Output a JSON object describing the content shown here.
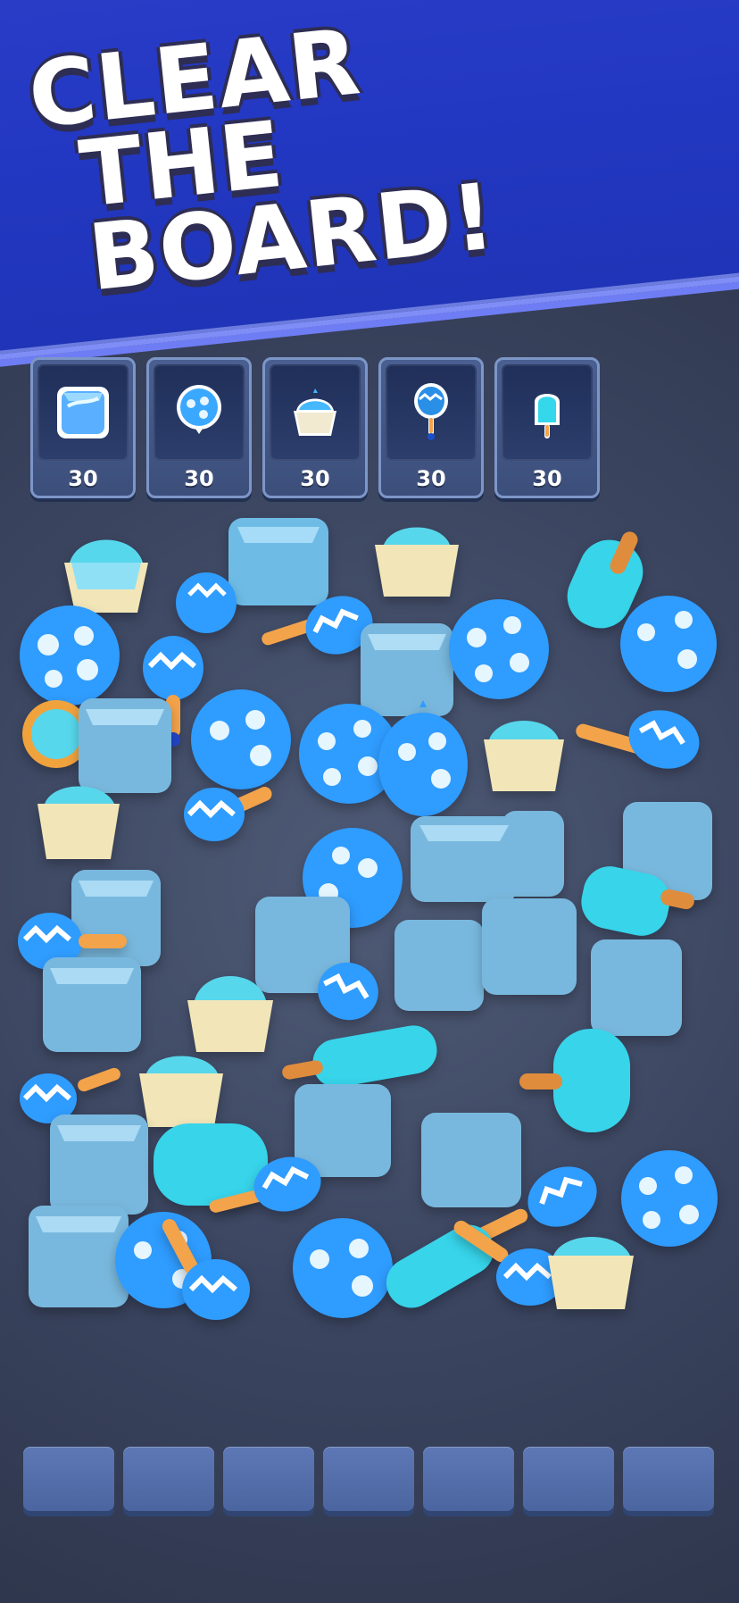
{
  "header": {
    "title_line_1": "CLEAR",
    "title_line_2": "THE BOARD!"
  },
  "goals": [
    {
      "icon": "ice-cube-icon",
      "count": "30"
    },
    {
      "icon": "balloon-icon",
      "count": "30"
    },
    {
      "icon": "cupcake-icon",
      "count": "30"
    },
    {
      "icon": "maraca-icon",
      "count": "30"
    },
    {
      "icon": "popsicle-icon",
      "count": "30"
    }
  ],
  "tray": {
    "slot_count": 7
  },
  "palette": {
    "banner": "#2338c3",
    "tile_blue": "#2f9cff",
    "ice_blue": "#7fc0e6",
    "cupcake_cream": "#f2e6b8",
    "popsicle_aqua": "#34d8ea",
    "stick_orange": "#e08c3d",
    "tray_slot": "#5670aa"
  }
}
